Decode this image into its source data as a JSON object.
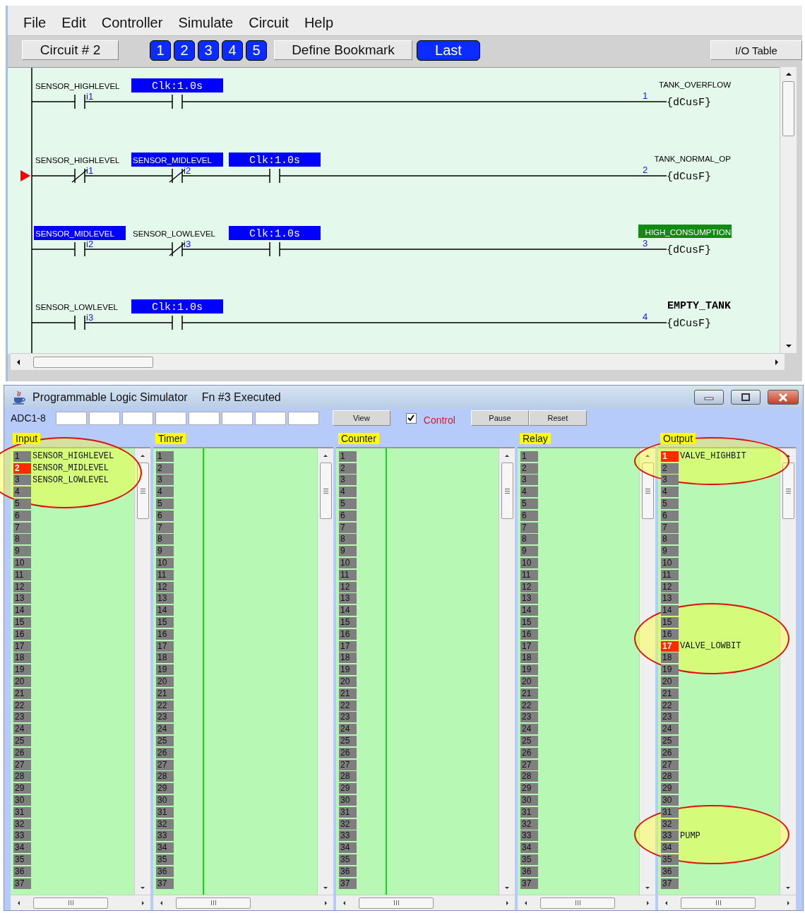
{
  "editor": {
    "menu": [
      "File",
      "Edit",
      "Controller",
      "Simulate",
      "Circuit",
      "Help"
    ],
    "circuit_button": "Circuit # 2",
    "bookmarks": [
      "1",
      "2",
      "3",
      "4",
      "5"
    ],
    "define_bookmark": "Define Bookmark",
    "last": "Last",
    "io_table": "I/O Table",
    "rungs": [
      {
        "current": false,
        "contacts": [
          {
            "label": "SENSOR_HIGHLEVEL",
            "tag": "i1",
            "kind": "no",
            "energized": false
          },
          {
            "label": "Clk:1.0s",
            "kind": "timer",
            "energized": true
          }
        ],
        "coil": {
          "name": "TANK_OVERFLOW",
          "number": "1",
          "text": "{dCusF}",
          "kind": "plain",
          "energized": false
        }
      },
      {
        "current": true,
        "contacts": [
          {
            "label": "SENSOR_HIGHLEVEL",
            "tag": "i1",
            "kind": "nc",
            "energized": false
          },
          {
            "label": "SENSOR_MIDLEVEL",
            "tag": "i2",
            "kind": "nc",
            "energized": true
          },
          {
            "label": "Clk:1.0s",
            "kind": "timer",
            "energized": true
          }
        ],
        "coil": {
          "name": "TANK_NORMAL_OP",
          "number": "2",
          "text": "{dCusF}",
          "kind": "plain",
          "energized": false
        }
      },
      {
        "current": false,
        "contacts": [
          {
            "label": "SENSOR_MIDLEVEL",
            "tag": "i2",
            "kind": "no",
            "energized": true
          },
          {
            "label": "SENSOR_LOWLEVEL",
            "tag": "i3",
            "kind": "nc",
            "energized": false
          },
          {
            "label": "Clk:1.0s",
            "kind": "timer",
            "energized": true
          }
        ],
        "coil": {
          "name": "HIGH_CONSUMPTION",
          "number": "3",
          "text": "{dCusF}",
          "kind": "plain",
          "energized": true
        }
      },
      {
        "current": false,
        "contacts": [
          {
            "label": "SENSOR_LOWLEVEL",
            "tag": "i3",
            "kind": "no",
            "energized": false
          },
          {
            "label": "Clk:1.0s",
            "kind": "timer",
            "energized": true
          }
        ],
        "coil": {
          "name": "EMPTY_TANK",
          "number": "4",
          "text": "{dCusF}",
          "kind": "mono",
          "energized": false
        }
      }
    ]
  },
  "simulator": {
    "title": "Programmable Logic Simulator",
    "status": "Fn #3 Executed",
    "adc_label": "ADC1-8",
    "view_button": "View",
    "control": {
      "label": "Control",
      "checked": true
    },
    "buttons": [
      "Pause",
      "Reset"
    ],
    "panels": [
      {
        "title": "Input",
        "column_line": false,
        "rows": [
          {
            "number": "1",
            "on": false,
            "circled": true,
            "label": "SENSOR_HIGHLEVEL"
          },
          {
            "number": "2",
            "on": true,
            "circled": true,
            "label": "SENSOR_MIDLEVEL"
          },
          {
            "number": "3",
            "on": false,
            "circled": true,
            "label": "SENSOR_LOWLEVEL"
          },
          {
            "number": "4",
            "on": false,
            "circled": true
          },
          {
            "number": "5",
            "on": false,
            "circled": false
          },
          {
            "number": "6",
            "on": false,
            "circled": false
          },
          {
            "number": "7",
            "on": false,
            "circled": false
          },
          {
            "number": "8",
            "on": false,
            "circled": false
          },
          {
            "number": "9",
            "on": false,
            "circled": false
          },
          {
            "number": "10",
            "on": false,
            "circled": false
          },
          {
            "number": "11",
            "on": false,
            "circled": false
          },
          {
            "number": "12",
            "on": false,
            "circled": false
          },
          {
            "number": "13",
            "on": false,
            "circled": false
          },
          {
            "number": "14",
            "on": false,
            "circled": false
          },
          {
            "number": "15",
            "on": false,
            "circled": false
          },
          {
            "number": "16",
            "on": false,
            "circled": false
          },
          {
            "number": "17",
            "on": false,
            "circled": false
          },
          {
            "number": "18",
            "on": false,
            "circled": false
          },
          {
            "number": "19",
            "on": false,
            "circled": false
          },
          {
            "number": "20",
            "on": false,
            "circled": false
          },
          {
            "number": "21",
            "on": false,
            "circled": false
          },
          {
            "number": "22",
            "on": false,
            "circled": false
          },
          {
            "number": "23",
            "on": false,
            "circled": false
          },
          {
            "number": "24",
            "on": false,
            "circled": false
          },
          {
            "number": "25",
            "on": false,
            "circled": false
          },
          {
            "number": "26",
            "on": false,
            "circled": false
          },
          {
            "number": "27",
            "on": false,
            "circled": false
          },
          {
            "number": "28",
            "on": false,
            "circled": false
          },
          {
            "number": "29",
            "on": false,
            "circled": false
          },
          {
            "number": "30",
            "on": false,
            "circled": false
          },
          {
            "number": "31",
            "on": false,
            "circled": false
          },
          {
            "number": "32",
            "on": false,
            "circled": false
          },
          {
            "number": "33",
            "on": false,
            "circled": false
          },
          {
            "number": "34",
            "on": false,
            "circled": false
          },
          {
            "number": "35",
            "on": false,
            "circled": false
          },
          {
            "number": "36",
            "on": false,
            "circled": false
          },
          {
            "number": "37",
            "on": false,
            "circled": false
          }
        ]
      },
      {
        "title": "Timer",
        "column_line": true,
        "rows": [
          {
            "number": "1",
            "on": false,
            "circled": false
          },
          {
            "number": "2",
            "on": false,
            "circled": false
          },
          {
            "number": "3",
            "on": false,
            "circled": false
          },
          {
            "number": "4",
            "on": false,
            "circled": false
          },
          {
            "number": "5",
            "on": false,
            "circled": false
          },
          {
            "number": "6",
            "on": false,
            "circled": false
          },
          {
            "number": "7",
            "on": false,
            "circled": false
          },
          {
            "number": "8",
            "on": false,
            "circled": false
          },
          {
            "number": "9",
            "on": false,
            "circled": false
          },
          {
            "number": "10",
            "on": false,
            "circled": false
          },
          {
            "number": "11",
            "on": false,
            "circled": false
          },
          {
            "number": "12",
            "on": false,
            "circled": false
          },
          {
            "number": "13",
            "on": false,
            "circled": false
          },
          {
            "number": "14",
            "on": false,
            "circled": false
          },
          {
            "number": "15",
            "on": false,
            "circled": false
          },
          {
            "number": "16",
            "on": false,
            "circled": false
          },
          {
            "number": "17",
            "on": false,
            "circled": false
          },
          {
            "number": "18",
            "on": false,
            "circled": false
          },
          {
            "number": "19",
            "on": false,
            "circled": false
          },
          {
            "number": "20",
            "on": false,
            "circled": false
          },
          {
            "number": "21",
            "on": false,
            "circled": false
          },
          {
            "number": "22",
            "on": false,
            "circled": false
          },
          {
            "number": "23",
            "on": false,
            "circled": false
          },
          {
            "number": "24",
            "on": false,
            "circled": false
          },
          {
            "number": "25",
            "on": false,
            "circled": false
          },
          {
            "number": "26",
            "on": false,
            "circled": false
          },
          {
            "number": "27",
            "on": false,
            "circled": false
          },
          {
            "number": "28",
            "on": false,
            "circled": false
          },
          {
            "number": "29",
            "on": false,
            "circled": false
          },
          {
            "number": "30",
            "on": false,
            "circled": false
          },
          {
            "number": "31",
            "on": false,
            "circled": false
          },
          {
            "number": "32",
            "on": false,
            "circled": false
          },
          {
            "number": "33",
            "on": false,
            "circled": false
          },
          {
            "number": "34",
            "on": false,
            "circled": false
          },
          {
            "number": "35",
            "on": false,
            "circled": false
          },
          {
            "number": "36",
            "on": false,
            "circled": false
          },
          {
            "number": "37",
            "on": false,
            "circled": false
          }
        ]
      },
      {
        "title": "Counter",
        "column_line": true,
        "rows": [
          {
            "number": "1",
            "on": false,
            "circled": false
          },
          {
            "number": "2",
            "on": false,
            "circled": false
          },
          {
            "number": "3",
            "on": false,
            "circled": false
          },
          {
            "number": "4",
            "on": false,
            "circled": false
          },
          {
            "number": "5",
            "on": false,
            "circled": false
          },
          {
            "number": "6",
            "on": false,
            "circled": false
          },
          {
            "number": "7",
            "on": false,
            "circled": false
          },
          {
            "number": "8",
            "on": false,
            "circled": false
          },
          {
            "number": "9",
            "on": false,
            "circled": false
          },
          {
            "number": "10",
            "on": false,
            "circled": false
          },
          {
            "number": "11",
            "on": false,
            "circled": false
          },
          {
            "number": "12",
            "on": false,
            "circled": false
          },
          {
            "number": "13",
            "on": false,
            "circled": false
          },
          {
            "number": "14",
            "on": false,
            "circled": false
          },
          {
            "number": "15",
            "on": false,
            "circled": false
          },
          {
            "number": "16",
            "on": false,
            "circled": false
          },
          {
            "number": "17",
            "on": false,
            "circled": false
          },
          {
            "number": "18",
            "on": false,
            "circled": false
          },
          {
            "number": "19",
            "on": false,
            "circled": false
          },
          {
            "number": "20",
            "on": false,
            "circled": false
          },
          {
            "number": "21",
            "on": false,
            "circled": false
          },
          {
            "number": "22",
            "on": false,
            "circled": false
          },
          {
            "number": "23",
            "on": false,
            "circled": false
          },
          {
            "number": "24",
            "on": false,
            "circled": false
          },
          {
            "number": "25",
            "on": false,
            "circled": false
          },
          {
            "number": "26",
            "on": false,
            "circled": false
          },
          {
            "number": "27",
            "on": false,
            "circled": false
          },
          {
            "number": "28",
            "on": false,
            "circled": false
          },
          {
            "number": "29",
            "on": false,
            "circled": false
          },
          {
            "number": "30",
            "on": false,
            "circled": false
          },
          {
            "number": "31",
            "on": false,
            "circled": false
          },
          {
            "number": "32",
            "on": false,
            "circled": false
          },
          {
            "number": "33",
            "on": false,
            "circled": false
          },
          {
            "number": "34",
            "on": false,
            "circled": false
          },
          {
            "number": "35",
            "on": false,
            "circled": false
          },
          {
            "number": "36",
            "on": false,
            "circled": false
          },
          {
            "number": "37",
            "on": false,
            "circled": false
          }
        ]
      },
      {
        "title": "Relay",
        "column_line": false,
        "rows": [
          {
            "number": "1",
            "on": false,
            "circled": false
          },
          {
            "number": "2",
            "on": false,
            "circled": false
          },
          {
            "number": "3",
            "on": false,
            "circled": false
          },
          {
            "number": "4",
            "on": false,
            "circled": false
          },
          {
            "number": "5",
            "on": false,
            "circled": false
          },
          {
            "number": "6",
            "on": false,
            "circled": false
          },
          {
            "number": "7",
            "on": false,
            "circled": false
          },
          {
            "number": "8",
            "on": false,
            "circled": false
          },
          {
            "number": "9",
            "on": false,
            "circled": false
          },
          {
            "number": "10",
            "on": false,
            "circled": false
          },
          {
            "number": "11",
            "on": false,
            "circled": false
          },
          {
            "number": "12",
            "on": false,
            "circled": false
          },
          {
            "number": "13",
            "on": false,
            "circled": false
          },
          {
            "number": "14",
            "on": false,
            "circled": false
          },
          {
            "number": "15",
            "on": false,
            "circled": false
          },
          {
            "number": "16",
            "on": false,
            "circled": false
          },
          {
            "number": "17",
            "on": false,
            "circled": false
          },
          {
            "number": "18",
            "on": false,
            "circled": false
          },
          {
            "number": "19",
            "on": false,
            "circled": false
          },
          {
            "number": "20",
            "on": false,
            "circled": false
          },
          {
            "number": "21",
            "on": false,
            "circled": false
          },
          {
            "number": "22",
            "on": false,
            "circled": false
          },
          {
            "number": "23",
            "on": false,
            "circled": false
          },
          {
            "number": "24",
            "on": false,
            "circled": false
          },
          {
            "number": "25",
            "on": false,
            "circled": false
          },
          {
            "number": "26",
            "on": false,
            "circled": false
          },
          {
            "number": "27",
            "on": false,
            "circled": false
          },
          {
            "number": "28",
            "on": false,
            "circled": false
          },
          {
            "number": "29",
            "on": false,
            "circled": false
          },
          {
            "number": "30",
            "on": false,
            "circled": false
          },
          {
            "number": "31",
            "on": false,
            "circled": false
          },
          {
            "number": "32",
            "on": false,
            "circled": false
          },
          {
            "number": "33",
            "on": false,
            "circled": false
          },
          {
            "number": "34",
            "on": false,
            "circled": false
          },
          {
            "number": "35",
            "on": false,
            "circled": false
          },
          {
            "number": "36",
            "on": false,
            "circled": false
          },
          {
            "number": "37",
            "on": false,
            "circled": false
          }
        ]
      },
      {
        "title": "Output",
        "column_line": false,
        "rows": [
          {
            "number": "1",
            "on": true,
            "circled": true,
            "label": "VALVE_HIGHBIT"
          },
          {
            "number": "2",
            "on": false,
            "circled": true
          },
          {
            "number": "3",
            "on": false,
            "circled": false
          },
          {
            "number": "4",
            "on": false,
            "circled": false
          },
          {
            "number": "5",
            "on": false,
            "circled": false
          },
          {
            "number": "6",
            "on": false,
            "circled": false
          },
          {
            "number": "7",
            "on": false,
            "circled": false
          },
          {
            "number": "8",
            "on": false,
            "circled": false
          },
          {
            "number": "9",
            "on": false,
            "circled": false
          },
          {
            "number": "10",
            "on": false,
            "circled": false
          },
          {
            "number": "11",
            "on": false,
            "circled": false
          },
          {
            "number": "12",
            "on": false,
            "circled": false
          },
          {
            "number": "13",
            "on": false,
            "circled": false
          },
          {
            "number": "14",
            "on": false,
            "circled": false
          },
          {
            "number": "15",
            "on": false,
            "circled": true
          },
          {
            "number": "16",
            "on": false,
            "circled": true
          },
          {
            "number": "17",
            "on": true,
            "circled": true,
            "label": "VALVE_LOWBIT"
          },
          {
            "number": "18",
            "on": false,
            "circled": true
          },
          {
            "number": "19",
            "on": false,
            "circled": false
          },
          {
            "number": "20",
            "on": false,
            "circled": false
          },
          {
            "number": "21",
            "on": false,
            "circled": false
          },
          {
            "number": "22",
            "on": false,
            "circled": false
          },
          {
            "number": "23",
            "on": false,
            "circled": false
          },
          {
            "number": "24",
            "on": false,
            "circled": false
          },
          {
            "number": "25",
            "on": false,
            "circled": false
          },
          {
            "number": "26",
            "on": false,
            "circled": false
          },
          {
            "number": "27",
            "on": false,
            "circled": false
          },
          {
            "number": "28",
            "on": false,
            "circled": false
          },
          {
            "number": "29",
            "on": false,
            "circled": false
          },
          {
            "number": "30",
            "on": false,
            "circled": false
          },
          {
            "number": "31",
            "on": false,
            "circled": false
          },
          {
            "number": "32",
            "on": false,
            "circled": true
          },
          {
            "number": "33",
            "on": false,
            "circled": true,
            "label": "PUMP"
          },
          {
            "number": "34",
            "on": false,
            "circled": true
          },
          {
            "number": "35",
            "on": false,
            "circled": false
          },
          {
            "number": "36",
            "on": false,
            "circled": false
          },
          {
            "number": "37",
            "on": false,
            "circled": false
          }
        ]
      }
    ]
  }
}
